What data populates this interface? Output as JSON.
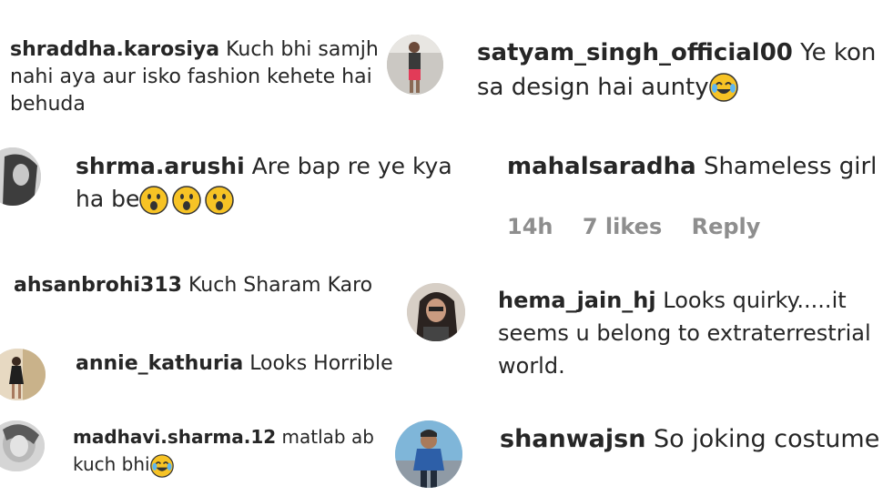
{
  "comments": [
    {
      "user": "shraddha.karosiya",
      "text": "Kuch bhi samjh nahi aya aur isko fashion kehete hai behuda",
      "emoji": ""
    },
    {
      "user": "satyam_singh_official00",
      "text": "Ye kon sa design hai aunty",
      "emoji": "laugh-cry-emoji"
    },
    {
      "user": "shrma.arushi",
      "text": "Are bap re ye kya ha be",
      "emoji": "astonished-emoji x3"
    },
    {
      "user": "mahalsaradha",
      "text": "Shameless girl",
      "emoji": ""
    },
    {
      "user": "ahsanbrohi313",
      "text": "Kuch Sharam Karo",
      "emoji": ""
    },
    {
      "user": "hema_jain_hj",
      "text": "Looks quirky.....it seems u belong to extraterrestrial world.",
      "emoji": ""
    },
    {
      "user": "annie_kathuria",
      "text": "Looks Horrible",
      "emoji": ""
    },
    {
      "user": "shanwajsn",
      "text": "So joking costume",
      "emoji": ""
    },
    {
      "user": "madhavi.sharma.12",
      "text": "matlab ab kuch bhi",
      "emoji": "laugh-cry-emoji"
    }
  ],
  "meta": {
    "time": "14h",
    "likes": "7 likes",
    "reply": "Reply"
  },
  "colors": {
    "text": "#262626",
    "meta": "#8e8e8e",
    "emoji_face": "#f7c325"
  }
}
